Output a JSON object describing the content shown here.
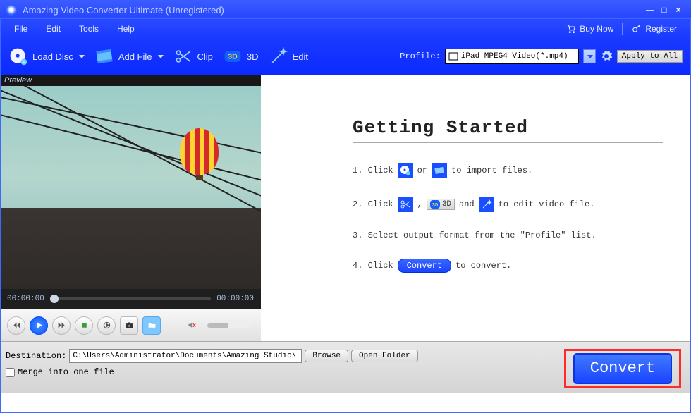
{
  "titlebar": {
    "title": "Amazing Video Converter Ultimate (Unregistered)"
  },
  "menubar": {
    "file": "File",
    "edit": "Edit",
    "tools": "Tools",
    "help": "Help",
    "buy_now": "Buy Now",
    "register": "Register"
  },
  "toolbar": {
    "load_disc": "Load Disc",
    "add_file": "Add File",
    "clip": "Clip",
    "three_d": "3D",
    "edit": "Edit",
    "profile_label": "Profile:",
    "profile_value": "iPad MPEG4 Video(*.mp4)",
    "apply_all": "Apply to All"
  },
  "preview": {
    "label": "Preview",
    "time_start": "00:00:00",
    "time_end": "00:00:00"
  },
  "getting_started": {
    "heading": "Getting Started",
    "step1_a": "1. Click",
    "step1_or": "or",
    "step1_b": "to import files.",
    "step2_a": "2. Click",
    "step2_comma": ",",
    "step2_and": "and",
    "step2_b": "to edit video file.",
    "step2_3d": "3D",
    "step3": "3. Select output format from the \"Profile\" list.",
    "step4_a": "4. Click",
    "step4_convert": "Convert",
    "step4_b": "to convert."
  },
  "bottom": {
    "destination_label": "Destination:",
    "destination_path": "C:\\Users\\Administrator\\Documents\\Amazing Studio\\",
    "browse": "Browse",
    "open_folder": "Open Folder",
    "merge": "Merge into one file",
    "convert": "Convert"
  }
}
